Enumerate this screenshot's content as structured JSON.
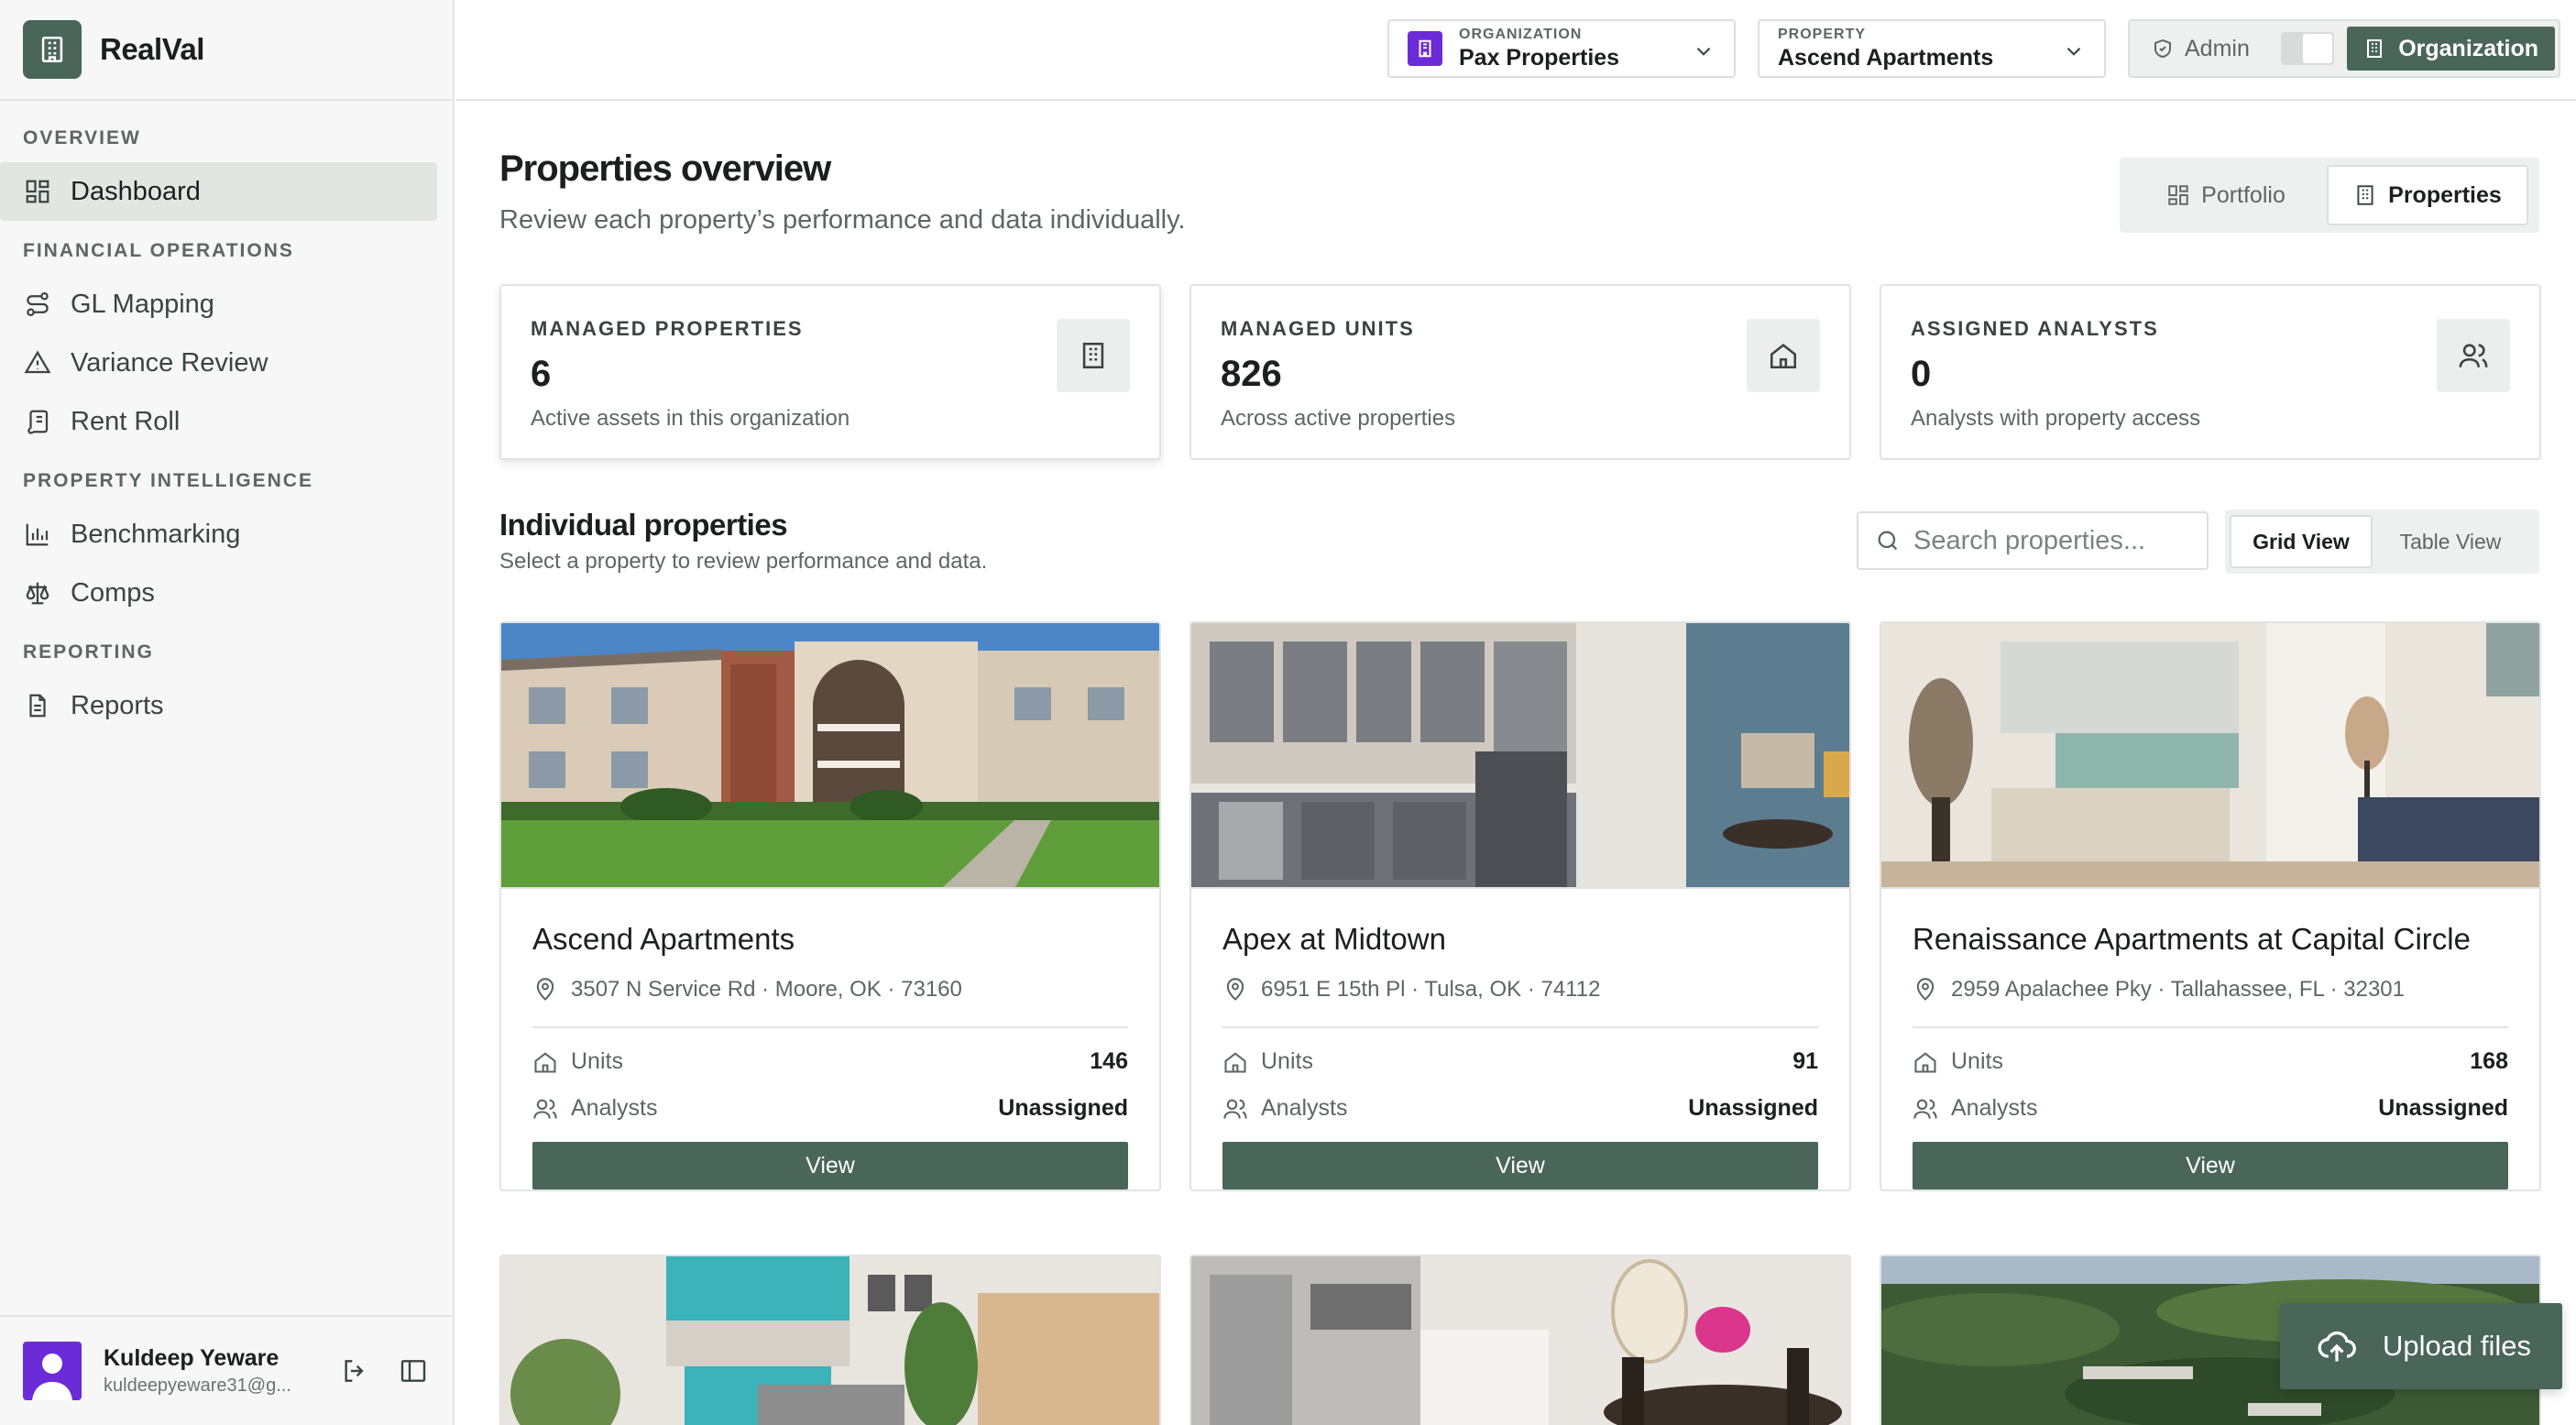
{
  "app": {
    "name": "RealVal"
  },
  "sidebar": {
    "sections": [
      {
        "title": "OVERVIEW",
        "items": [
          {
            "label": "Dashboard",
            "icon": "grid-icon",
            "active": true
          }
        ]
      },
      {
        "title": "FINANCIAL OPERATIONS",
        "items": [
          {
            "label": "GL Mapping",
            "icon": "route-icon"
          },
          {
            "label": "Variance Review",
            "icon": "warning-icon"
          },
          {
            "label": "Rent Roll",
            "icon": "scroll-icon"
          }
        ]
      },
      {
        "title": "PROPERTY INTELLIGENCE",
        "items": [
          {
            "label": "Benchmarking",
            "icon": "bar-chart-icon"
          },
          {
            "label": "Comps",
            "icon": "scale-icon"
          }
        ]
      },
      {
        "title": "REPORTING",
        "items": [
          {
            "label": "Reports",
            "icon": "document-icon"
          }
        ]
      }
    ],
    "user": {
      "name": "Kuldeep Yeware",
      "email": "kuldeepyeware31@g..."
    }
  },
  "topbar": {
    "organization": {
      "label": "ORGANIZATION",
      "value": "Pax Properties"
    },
    "property": {
      "label": "PROPERTY",
      "value": "Ascend Apartments"
    },
    "mode": {
      "admin": "Admin",
      "organization": "Organization"
    }
  },
  "main": {
    "title": "Properties overview",
    "subtitle": "Review each property’s performance and data individually.",
    "view_switch": {
      "portfolio": "Portfolio",
      "properties": "Properties"
    },
    "stats": [
      {
        "label": "MANAGED PROPERTIES",
        "value": "6",
        "note": "Active assets in this organization",
        "icon": "building-icon"
      },
      {
        "label": "MANAGED UNITS",
        "value": "826",
        "note": "Across active properties",
        "icon": "home-icon"
      },
      {
        "label": "ASSIGNED ANALYSTS",
        "value": "0",
        "note": "Analysts with property access",
        "icon": "users-icon"
      }
    ],
    "section_title": "Individual properties",
    "section_subtitle": "Select a property to review performance and data.",
    "search_placeholder": "Search properties...",
    "grid_view": "Grid View",
    "table_view": "Table View",
    "units_label": "Units",
    "analysts_label": "Analysts",
    "view_label": "View",
    "properties": [
      {
        "name": "Ascend Apartments",
        "address": "3507 N Service Rd · Moore, OK · 73160",
        "units": "146",
        "analysts": "Unassigned"
      },
      {
        "name": "Apex at Midtown",
        "address": "6951 E 15th Pl · Tulsa, OK · 74112",
        "units": "91",
        "analysts": "Unassigned"
      },
      {
        "name": "Renaissance Apartments at Capital Circle",
        "address": "2959 Apalachee Pky · Tallahassee, FL · 32301",
        "units": "168",
        "analysts": "Unassigned"
      }
    ],
    "upload_label": "Upload files"
  },
  "colors": {
    "accent": "#4a6659",
    "sidebar_bg": "#f6f7f6",
    "avatar": "#6c2bd9"
  }
}
